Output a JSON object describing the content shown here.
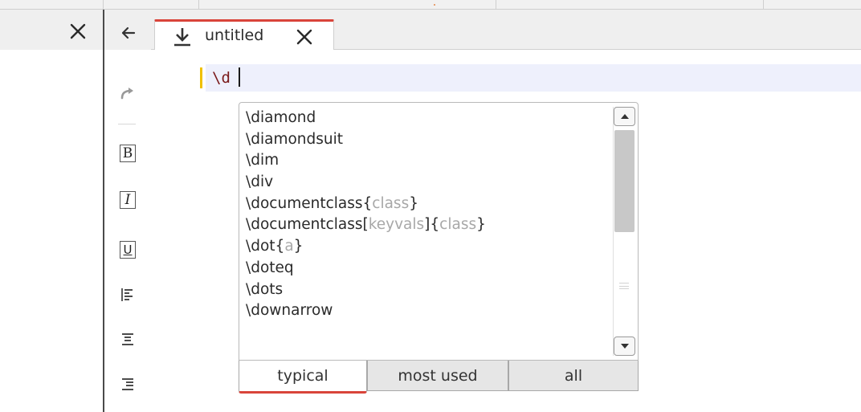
{
  "editor_tab": {
    "title": "untitled"
  },
  "editor": {
    "current_line_text": "\\d"
  },
  "completer": {
    "items": [
      {
        "cmd": "\\diamond",
        "arg1": "",
        "mid": "",
        "arg2": "",
        "end": ""
      },
      {
        "cmd": "\\diamondsuit",
        "arg1": "",
        "mid": "",
        "arg2": "",
        "end": ""
      },
      {
        "cmd": "\\dim",
        "arg1": "",
        "mid": "",
        "arg2": "",
        "end": ""
      },
      {
        "cmd": "\\div",
        "arg1": "",
        "mid": "",
        "arg2": "",
        "end": ""
      },
      {
        "cmd": "\\documentclass{",
        "arg1": "class",
        "mid": "}",
        "arg2": "",
        "end": ""
      },
      {
        "cmd": "\\documentclass[",
        "arg1": "keyvals",
        "mid": "]{",
        "arg2": "class",
        "end": "}"
      },
      {
        "cmd": "\\dot{",
        "arg1": "a",
        "mid": "}",
        "arg2": "",
        "end": ""
      },
      {
        "cmd": "\\doteq",
        "arg1": "",
        "mid": "",
        "arg2": "",
        "end": ""
      },
      {
        "cmd": "\\dots",
        "arg1": "",
        "mid": "",
        "arg2": "",
        "end": ""
      },
      {
        "cmd": "\\downarrow",
        "arg1": "",
        "mid": "",
        "arg2": "",
        "end": ""
      }
    ],
    "tabs": [
      {
        "label": "typical",
        "active": true
      },
      {
        "label": "most used",
        "active": false
      },
      {
        "label": "all",
        "active": false
      }
    ],
    "scroll_position": 0.0,
    "scroll_visible_fraction": 0.5
  },
  "toolbar": {
    "bold_label": "B",
    "italic_label": "I",
    "underline_label": "U"
  },
  "colors": {
    "accent": "#d9443a",
    "current_line": "#eef0fc",
    "marker": "#f0c000",
    "argument_text": "#a8a8a8"
  },
  "icons": {
    "left_panel": "close-icon",
    "toolbar": [
      "undo-icon",
      "redo-icon",
      "bold-icon",
      "italic-icon",
      "underline-icon",
      "align-left-icon",
      "align-center-icon",
      "align-right-icon"
    ],
    "tab": [
      "download-icon",
      "close-icon"
    ]
  }
}
